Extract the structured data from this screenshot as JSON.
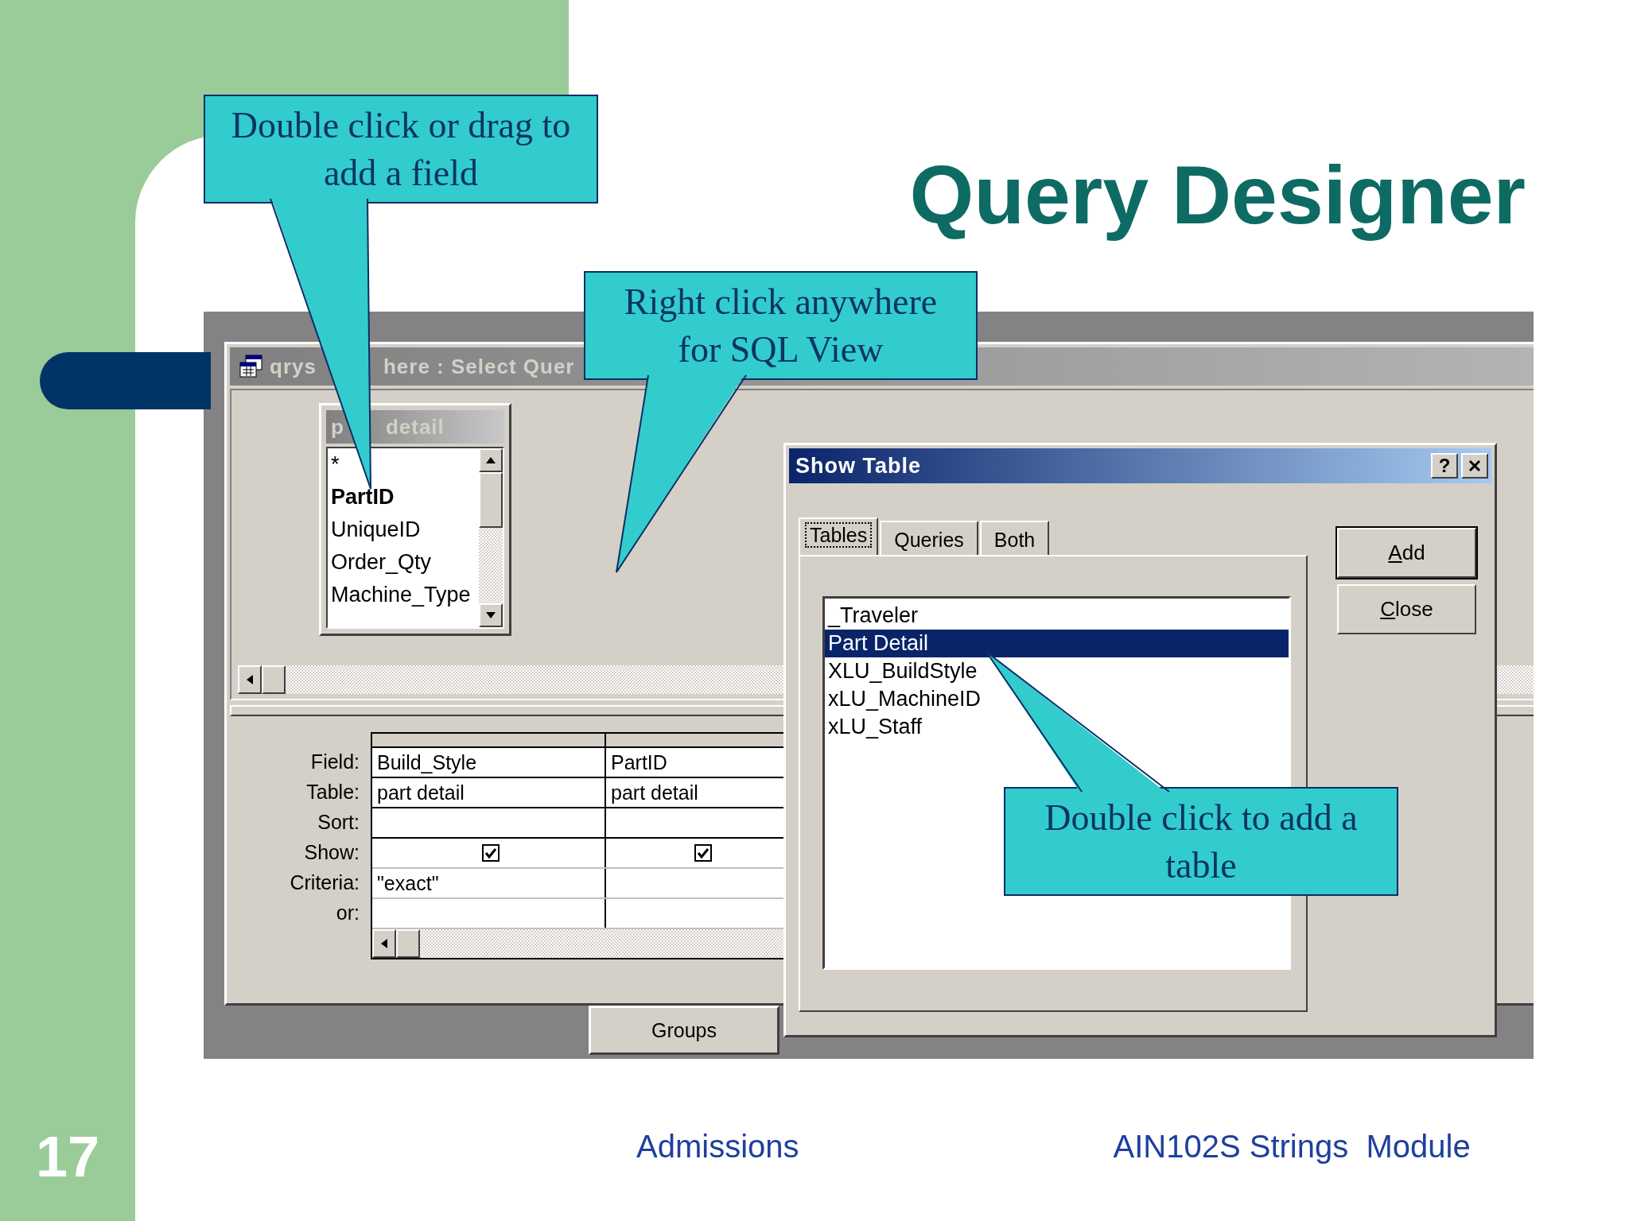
{
  "slide": {
    "title": "Query Designer",
    "number": "17",
    "footer_left": "Admissions",
    "footer_right": "AIN102S Strings  Module"
  },
  "query_window": {
    "title_parts": [
      "qrys",
      "here : Select Quer"
    ],
    "field_list": {
      "title_parts": [
        "p",
        "detail"
      ],
      "fields": [
        {
          "name": "*",
          "primary_key": false
        },
        {
          "name": "PartID",
          "primary_key": true
        },
        {
          "name": "UniqueID",
          "primary_key": false
        },
        {
          "name": "Order_Qty",
          "primary_key": false
        },
        {
          "name": "Machine_Type",
          "primary_key": false
        }
      ]
    },
    "grid": {
      "row_labels": [
        "Field:",
        "Table:",
        "Sort:",
        "Show:",
        "Criteria:",
        "or:"
      ],
      "columns": [
        {
          "field": "Build_Style",
          "table": "part detail",
          "show": true,
          "criteria": "\"exact\""
        },
        {
          "field": "PartID",
          "table": "part detail",
          "show": true
        }
      ]
    },
    "groups_tab": "Groups"
  },
  "show_table": {
    "title": "Show Table",
    "help": "?",
    "tabs": [
      {
        "label": "Tables",
        "selected": true
      },
      {
        "label": "Queries",
        "selected": false
      },
      {
        "label": "Both",
        "selected": false
      }
    ],
    "items": [
      {
        "name": "_Traveler",
        "selected": false
      },
      {
        "name": "Part Detail",
        "selected": true
      },
      {
        "name": "XLU_BuildStyle",
        "selected": false
      },
      {
        "name": "xLU_MachineID",
        "selected": false
      },
      {
        "name": "xLU_Staff",
        "selected": false
      }
    ],
    "buttons": [
      "Add",
      "Close"
    ]
  },
  "callouts": [
    {
      "text": "Double click or drag to add a field"
    },
    {
      "text": "Right click anywhere for SQL View"
    },
    {
      "text": "Double click to add a table"
    }
  ]
}
